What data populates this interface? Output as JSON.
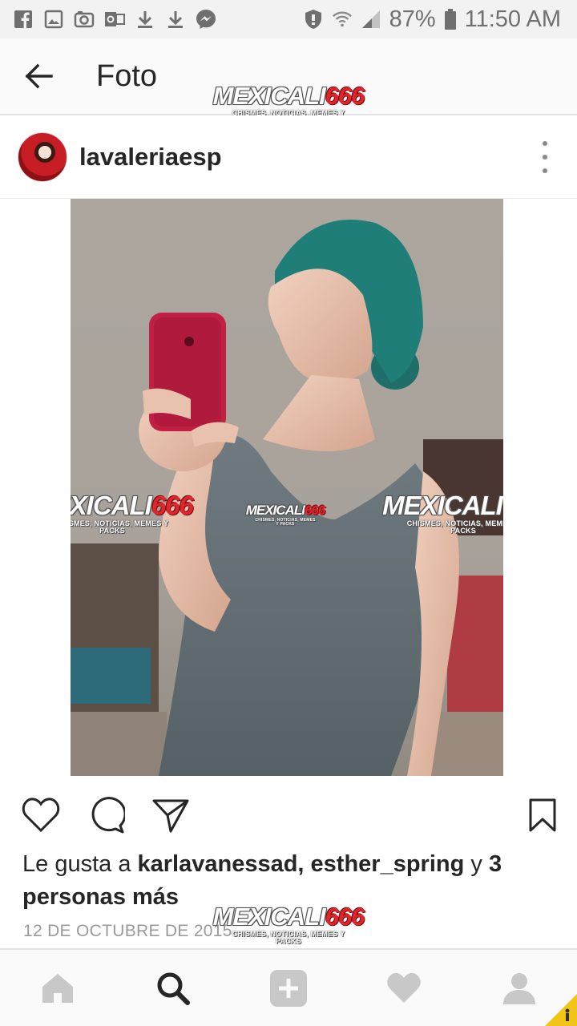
{
  "status_bar": {
    "left_icons": [
      "facebook-icon",
      "image-icon",
      "camera-icon",
      "outlook-icon",
      "download-icon",
      "download-icon",
      "messenger-icon"
    ],
    "right_icons": [
      "shield-icon",
      "wifi-icon",
      "signal-icon",
      "battery-icon"
    ],
    "battery": "87%",
    "time": "11:50 AM"
  },
  "app_bar": {
    "back_icon": "arrow-left-icon",
    "title": "Foto"
  },
  "post": {
    "username": "lavaleriaesp",
    "more_icon": "more-vertical-icon"
  },
  "watermark": {
    "text_white": "MEXICALI",
    "text_red": "666",
    "subtitle": "CHISMES, NOTICIAS, MEMES Y PACKS"
  },
  "actions": {
    "like_icon": "heart-icon",
    "comment_icon": "comment-icon",
    "share_icon": "send-icon",
    "save_icon": "bookmark-icon"
  },
  "likes": {
    "prefix": "Le gusta a ",
    "users": "karlavanessad, esther_spring",
    "middle": " y ",
    "others": "3 personas más"
  },
  "date": "12 DE OCTUBRE DE 2015",
  "bottom_nav": {
    "items": [
      "home-icon",
      "search-icon",
      "add-icon",
      "heart-icon",
      "profile-icon"
    ]
  },
  "colors": {
    "accent_red": "#e0262c",
    "text": "#262626",
    "muted": "#9a9a9a",
    "hair_teal": "#1f7f78",
    "phone_red": "#c21f45",
    "dress_gray": "#5f6b70"
  }
}
